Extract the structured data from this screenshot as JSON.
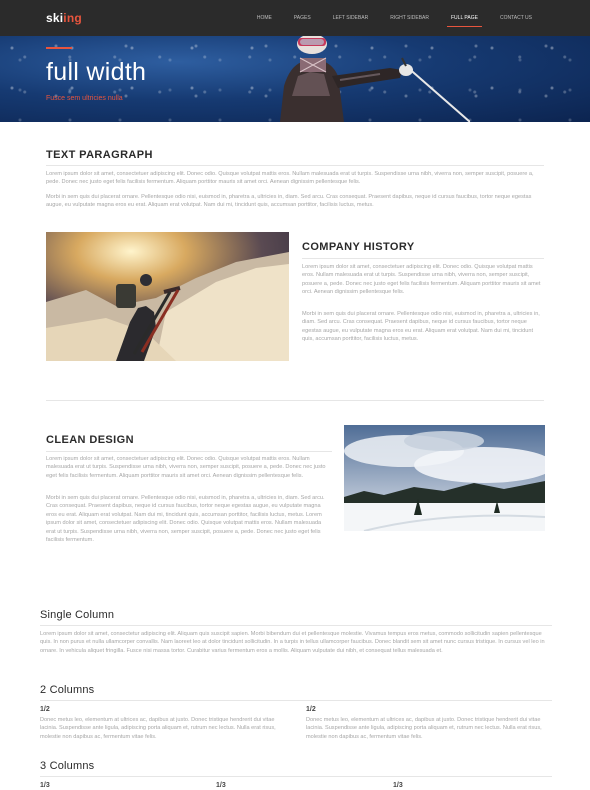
{
  "header": {
    "logo_part1": "ski",
    "logo_part2": "ing",
    "nav": [
      "HOME",
      "PAGES",
      "LEFT SIDEBAR",
      "RIGHT SIDEBAR",
      "FULL PAGE",
      "CONTACT US"
    ],
    "active_nav": "FULL PAGE"
  },
  "hero": {
    "title": "full width",
    "subtitle": "Fusce sem ultricies nulla"
  },
  "text_paragraph": {
    "title": "TEXT PARAGRAPH",
    "p1": "Lorem ipsum dolor sit amet, consectetuer adipiscing elit. Donec odio. Quisque volutpat mattis eros. Nullam malesuada erat ut turpis. Suspendisse urna nibh, viverra non, semper suscipit, posuere a, pede. Donec nec justo eget felis facilisis fermentum. Aliquam porttitor mauris sit amet orci. Aenean dignissim pellentesque felis.",
    "p2": "Morbi in sem quis dui placerat ornare. Pellentesque odio nisi, euismod in, pharetra a, ultricies in, diam. Sed arcu. Cras consequat. Praesent dapibus, neque id cursus faucibus, tortor neque egestas augue, eu vulputate magna eros eu erat. Aliquam erat volutpat. Nam dui mi, tincidunt quis, accumsan porttitor, facilisis luctus, metus."
  },
  "company_history": {
    "title": "COMPANY HISTORY",
    "p1": "Lorem ipsum dolor sit amet, consectetuer adipiscing elit. Donec odio. Quisque volutpat mattis eros. Nullam malesuada erat ut turpis. Suspendisse urna nibh, viverra non, semper suscipit, posuere a, pede. Donec nec justo eget felis facilisis fermentum. Aliquam porttitor mauris sit amet orci. Aenean dignissim pellentesque felis.",
    "p2": "Morbi in sem quis dui placerat ornare. Pellentesque odio nisi, euismod in, pharetra a, ultricies in, diam. Sed arcu. Cras consequat. Praesent dapibus, neque id cursus faucibus, tortor neque egestas augue, eu vulputate magna eros eu erat. Aliquam erat volutpat. Nam dui mi, tincidunt quis, accumsan porttitor, facilisis luctus, metus."
  },
  "clean_design": {
    "title": "CLEAN DESIGN",
    "p1": "Lorem ipsum dolor sit amet, consectetuer adipiscing elit. Donec odio. Quisque volutpat mattis eros. Nullam malesuada erat ut turpis. Suspendisse urna nibh, viverra non, semper suscipit, posuere a, pede. Donec nec justo eget felis facilisis fermentum. Aliquam porttitor mauris sit amet orci. Aenean dignissim pellentesque felis.",
    "p2": "Morbi in sem quis dui placerat ornare. Pellentesque odio nisi, euismod in, pharetra a, ultricies in, diam. Sed arcu. Cras consequat. Praesent dapibus, neque id cursus faucibus, tortor neque egestas augue, eu vulputate magna eros eu erat. Aliquam erat volutpat. Nam dui mi, tincidunt quis, accumsan porttitor, facilisis luctus, metus. Lorem ipsum dolor sit amet, consectetuer adipiscing elit. Donec odio. Quisque volutpat mattis eros. Nullam malesuada erat ut turpis. Suspendisse urna nibh, viverra non, semper suscipit, posuere a, pede. Donec nec justo eget felis facilisis fermentum."
  },
  "single_column": {
    "title": "Single Column",
    "p1": "Lorem ipsum dolor sit amet, consectetur adipiscing elit. Aliquam quis suscipit sapien. Morbi bibendum dui et pellentesque molestie. Vivamus tempus eros metus, commodo sollicitudin sapien pellentesque quis. In non purus et nulla ullamcorper convallis. Nam laoreet leo at dolor tincidunt sollicitudin. In a turpis in tellus ullamcorper faucibus. Donec blandit sem sit amet nunc cursus tristique. In cursus vel leo in ornare. In vehicula aliquet fringilla. Fusce nisi massa tortor. Curabitur varius fermentum eros a mollis. Aliquam vulputate dui nibh, et consequat tellus malesuada et."
  },
  "two_columns": {
    "title": "2 Columns",
    "cols": [
      {
        "label": "1/2",
        "text": "Donec metus leo, elementum at ultrices ac, dapibus at justo. Donec tristique hendrerit dui vitae lacinia. Suspendisse ante ligula, adipiscing porta aliquam et, rutrum nec lectus. Nulla erat risus, molestie non dapibus ac, fermentum vitae felis."
      },
      {
        "label": "1/2",
        "text": "Donec metus leo, elementum at ultrices ac, dapibus at justo. Donec tristique hendrerit dui vitae lacinia. Suspendisse ante ligula, adipiscing porta aliquam et, rutrum nec lectus. Nulla erat risus, molestie non dapibus ac, fermentum vitae felis."
      }
    ]
  },
  "three_columns": {
    "title": "3 Columns",
    "labels": [
      "1/3",
      "1/3",
      "1/3"
    ]
  },
  "colors": {
    "accent": "#e8553e",
    "navbar": "#2b2b2b",
    "hero": "#163a72"
  }
}
